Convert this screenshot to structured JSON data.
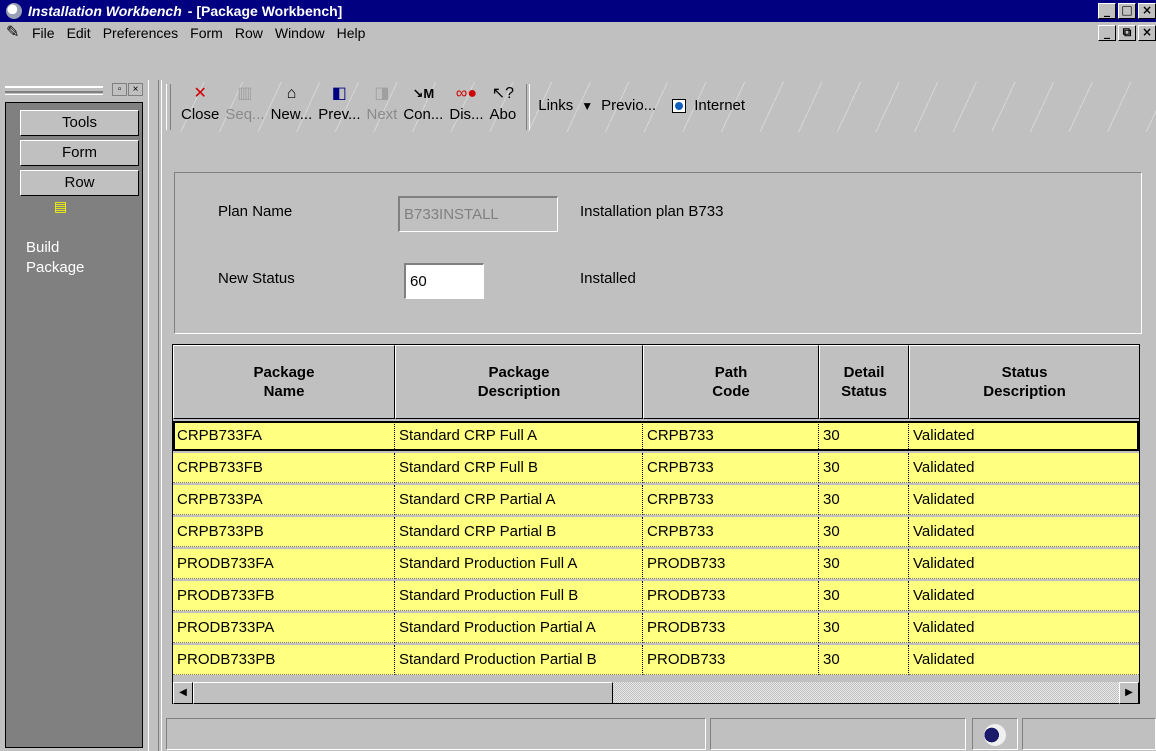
{
  "window": {
    "app_title": "Installation Workbench",
    "doc_title": "- [Package Workbench]",
    "controls": [
      "_",
      "□",
      "×"
    ],
    "mdi_controls": [
      "_",
      "⧉",
      "×"
    ]
  },
  "menubar": {
    "items": [
      "File",
      "Edit",
      "Preferences",
      "Form",
      "Row",
      "Window",
      "Help"
    ]
  },
  "sidebar": {
    "tabs": [
      "Tools",
      "Form",
      "Row"
    ],
    "exits": [
      {
        "label_line1": "Build",
        "label_line2": "Package",
        "icon": "build-package-icon"
      }
    ]
  },
  "toolbar": {
    "buttons": [
      {
        "label": "Close",
        "icon": "close-x-icon",
        "enabled": true
      },
      {
        "label": "Seq...",
        "icon": "sequence-icon",
        "enabled": false
      },
      {
        "label": "New...",
        "icon": "new-icon",
        "enabled": true
      },
      {
        "label": "Prev...",
        "icon": "previous-icon",
        "enabled": true
      },
      {
        "label": "Next",
        "icon": "next-icon",
        "enabled": false
      },
      {
        "label": "Con...",
        "icon": "connect-icon",
        "enabled": true
      },
      {
        "label": "Dis...",
        "icon": "display-icon",
        "enabled": true
      },
      {
        "label": "Abo",
        "icon": "about-icon",
        "enabled": true
      }
    ],
    "links": "Links",
    "previous": "Previo...",
    "internet": "Internet"
  },
  "header": {
    "plan_name_label": "Plan Name",
    "plan_name_value": "B733INSTALL",
    "plan_description": "Installation plan B733",
    "new_status_label": "New Status",
    "new_status_value": "60",
    "new_status_description": "Installed"
  },
  "grid": {
    "columns": [
      {
        "line1": "Package",
        "line2": "Name"
      },
      {
        "line1": "Package",
        "line2": "Description"
      },
      {
        "line1": "Path",
        "line2": "Code"
      },
      {
        "line1": "Detail",
        "line2": "Status"
      },
      {
        "line1": "Status",
        "line2": "Description"
      }
    ],
    "rows": [
      [
        "CRPB733FA",
        "Standard CRP Full A",
        "CRPB733",
        "30",
        "Validated"
      ],
      [
        "CRPB733FB",
        "Standard CRP Full B",
        "CRPB733",
        "30",
        "Validated"
      ],
      [
        "CRPB733PA",
        "Standard CRP Partial A",
        "CRPB733",
        "30",
        "Validated"
      ],
      [
        "CRPB733PB",
        "Standard CRP Partial B",
        "CRPB733",
        "30",
        "Validated"
      ],
      [
        "PRODB733FA",
        "Standard Production Full A",
        "PRODB733",
        "30",
        "Validated"
      ],
      [
        "PRODB733FB",
        "Standard Production Full B",
        "PRODB733",
        "30",
        "Validated"
      ],
      [
        "PRODB733PA",
        "Standard Production Partial A",
        "PRODB733",
        "30",
        "Validated"
      ],
      [
        "PRODB733PB",
        "Standard Production Partial B",
        "PRODB733",
        "30",
        "Validated"
      ]
    ]
  },
  "colors": {
    "title_bar": "#000080",
    "row_highlight": "#ffff80",
    "chrome": "#c0c0c0",
    "sidebar": "#808080"
  }
}
